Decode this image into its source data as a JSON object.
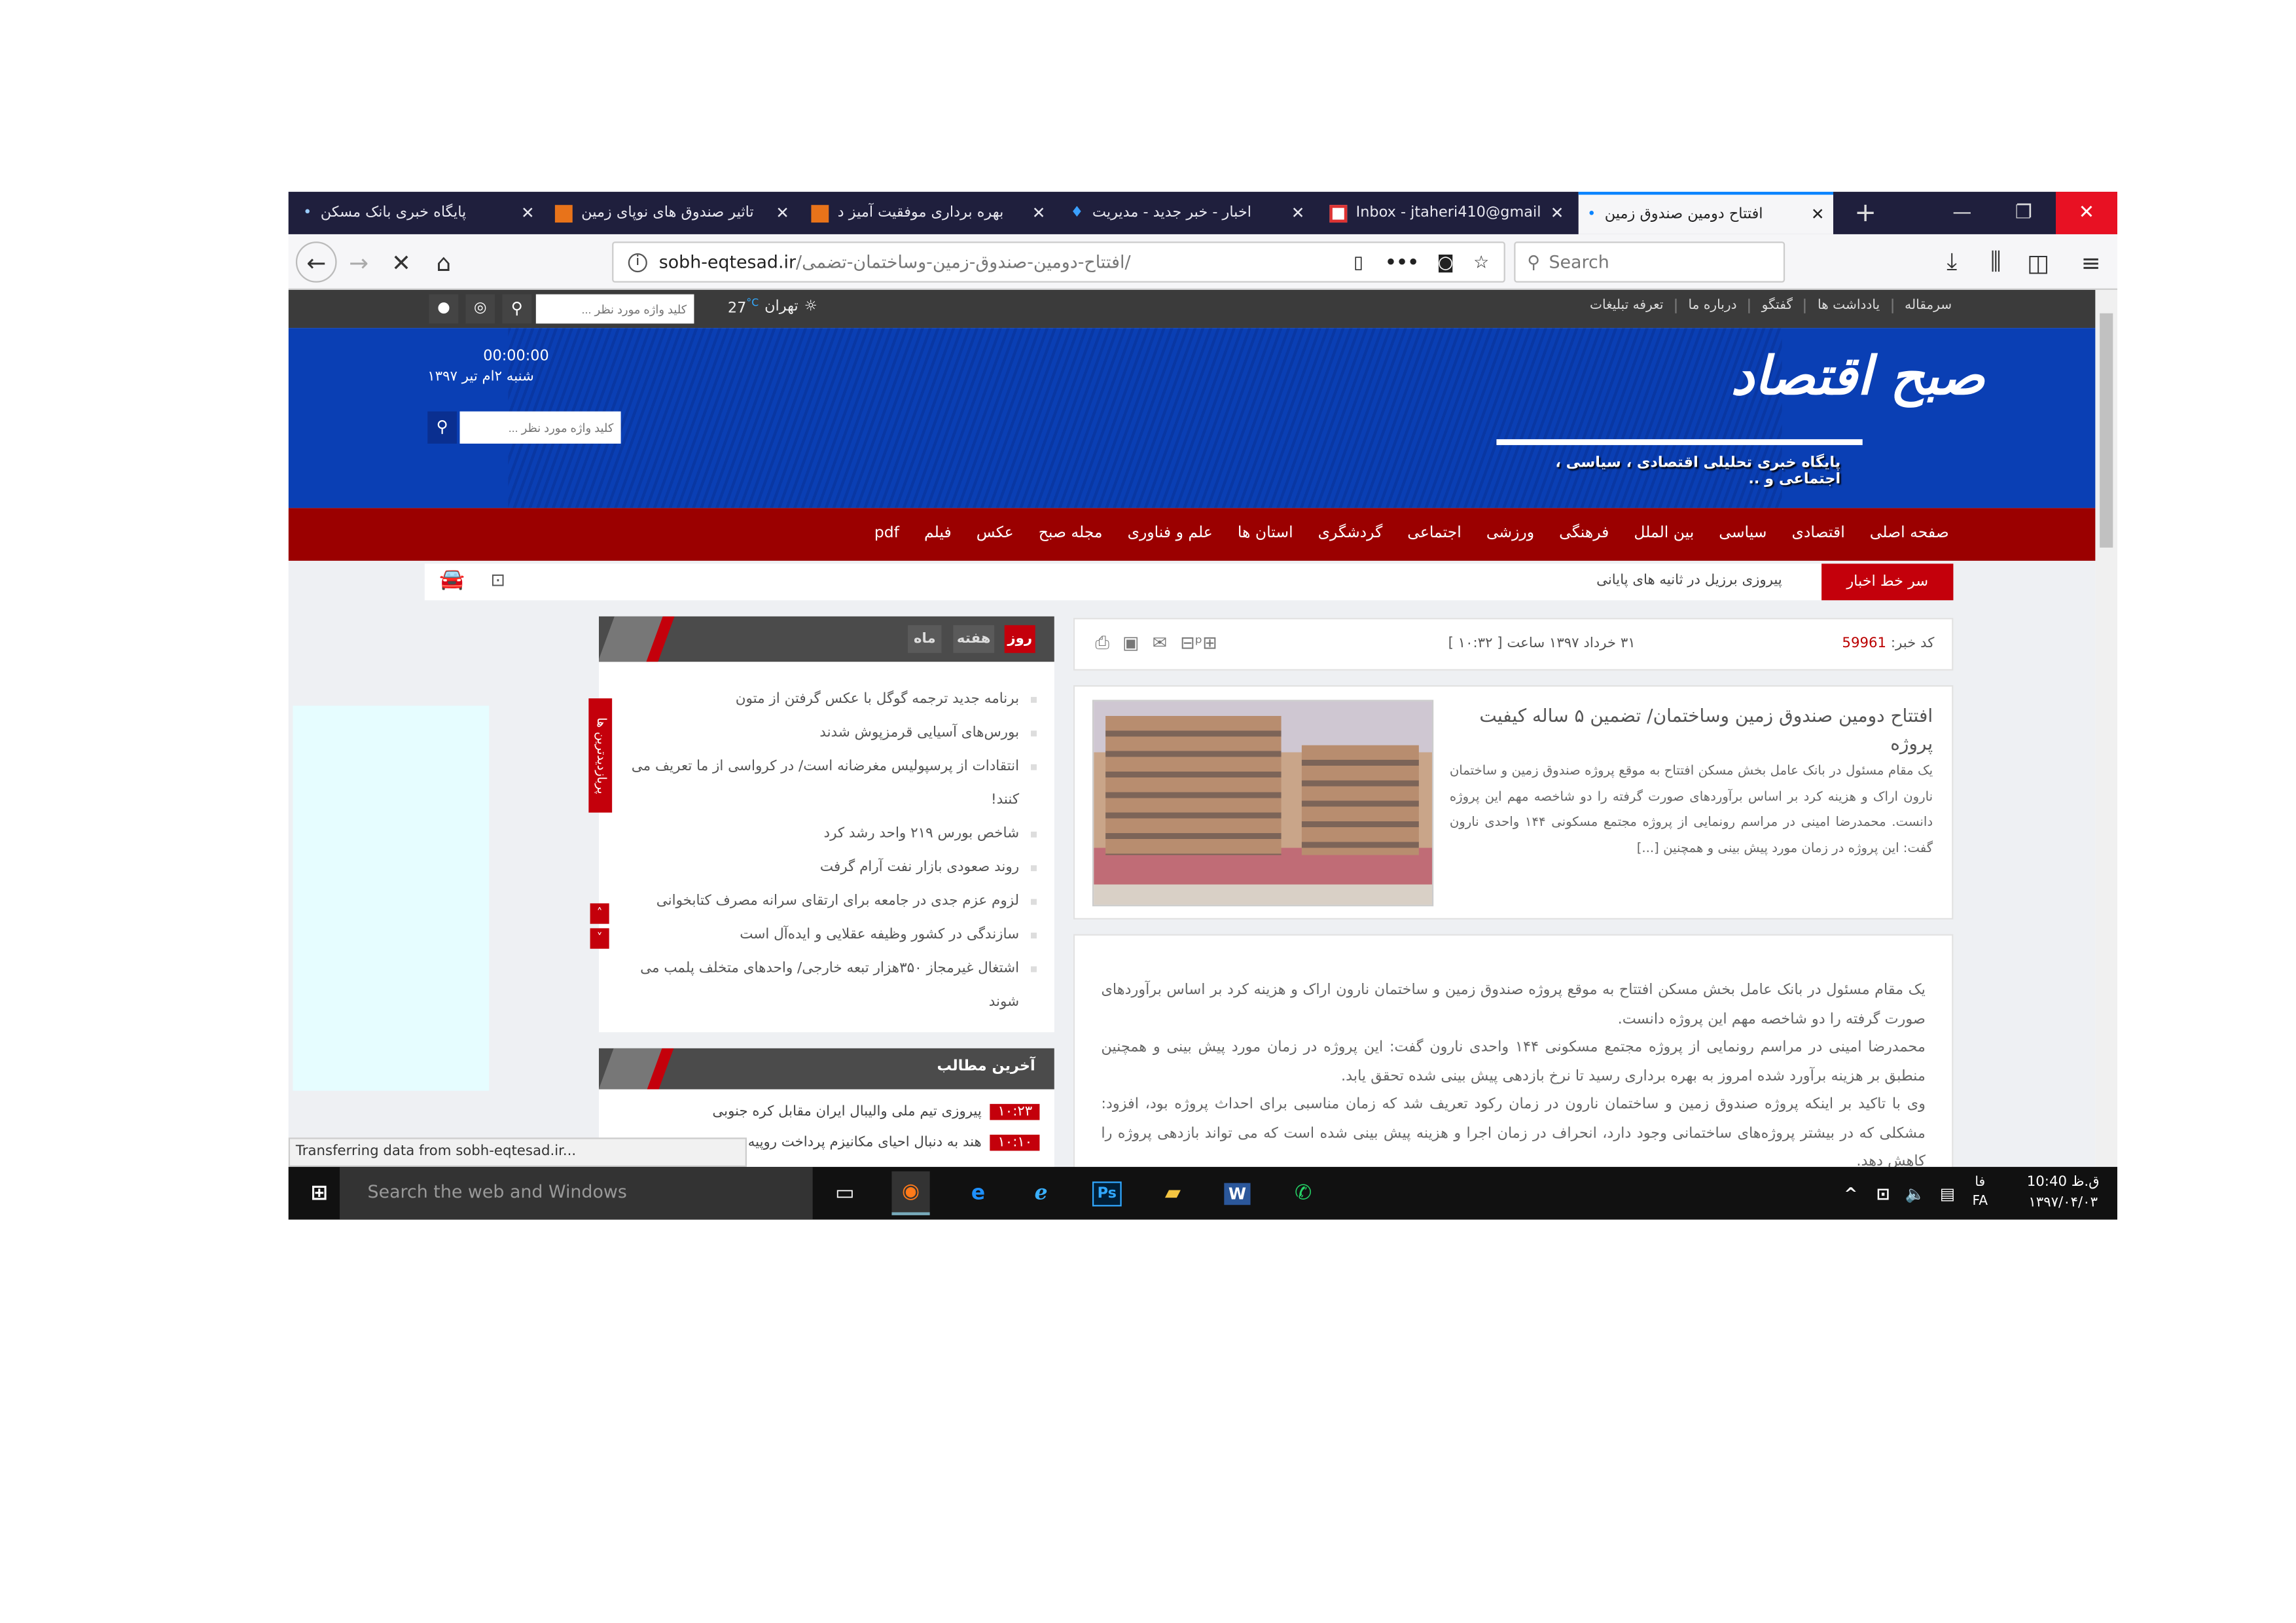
{
  "browser": {
    "tabs": [
      {
        "title": "پایگاه خبری بانک مسکن",
        "active": false
      },
      {
        "title": "تاثیر صندوق های نوپای زمین",
        "active": false
      },
      {
        "title": "بهره برداری موفقیت آمیز د",
        "active": false
      },
      {
        "title": "اخبار - خبر جدید - مدیریت",
        "active": false
      },
      {
        "title": "Inbox - jtaheri410@gmail",
        "active": false
      },
      {
        "title": "افتتاح دومین صندوق زمین",
        "active": true
      }
    ],
    "url_host": "sobh-eqtesad.ir",
    "url_path": "/افتتاح-دومین-صندوق-زمین-وساختمان-تضمی/",
    "search_placeholder": "Search",
    "status": "Transferring data from sobh-eqtesad.ir...",
    "accent": "#0a84ff"
  },
  "site": {
    "top_links": [
      "سرمقاله",
      "یادداشت ها",
      "گفتگو",
      "درباره ما",
      "تعرفه تبلیغات"
    ],
    "weather_city": "تهران",
    "weather_temp": "27",
    "weather_unit": "°C",
    "search_placeholder": "کلید واژه مورد نظر ...",
    "logo": "صبح اقتصاد",
    "tagline": "پایگاه خبری تحلیلی اقتصادی ، سیاسی ، اجتماعی و ..",
    "clock": "00:00:00",
    "date": "شنبه ۲ام تیر ۱۳۹۷",
    "nav": [
      "صفحه اصلی",
      "اقتصادی",
      "سیاسی",
      "بین الملل",
      "فرهنگی",
      "ورزشی",
      "اجتماعی",
      "گردشگری",
      "استان ها",
      "علم و فناوری",
      "مجله صبح",
      "عکس",
      "فیلم",
      "pdf"
    ],
    "ticker_label": "سر خط اخبار",
    "ticker_text": "پیروزی برزیل در ثانیه های پایانی",
    "colors": {
      "header_blue": "#0a3fb4",
      "nav_red": "#9b0000",
      "accent_red": "#c4000b"
    }
  },
  "article": {
    "code_label": "کد خبر:",
    "code": "59961",
    "date": "۳۱ خرداد ۱۳۹۷ ساعت [ ۱۰:۳۲ ]",
    "title": "افتتاح دومین صندوق زمین وساختمان/ تضمین ۵ ساله کیفیت پروژه",
    "lead": "یک مقام مسئول در بانک عامل بخش مسکن افتتاح به موقع پروژه صندوق زمین و ساختمان نارون اراک و هزینه کرد بر اساس برآوردهای صورت گرفته را دو شاخصه مهم این پروژه دانست.  محمدرضا امینی در مراسم رونمایی از پروژه مجتمع مسکونی ۱۴۴ واحدی نارون گفت: این پروژه در زمان مورد پیش بینی و همچنین [...]",
    "body": [
      "یک مقام مسئول در بانک عامل بخش مسکن افتتاح به موقع پروژه صندوق زمین و ساختمان نارون اراک و هزینه کرد بر اساس برآوردهای صورت گرفته را دو شاخصه مهم این پروژه دانست.",
      "محمدرضا امینی در مراسم رونمایی از پروژه مجتمع مسکونی ۱۴۴ واحدی نارون گفت: این پروژه در زمان مورد پیش بینی و همچنین منطبق بر هزینه برآورد شده امروز به بهره برداری رسید تا نرخ بازدهی پیش بینی شده تحقق یابد.",
      "وی با تاکید بر اینکه پروژه صندوق زمین و ساختمان نارون در زمان رکود تعریف شد که زمان مناسبی برای احداث پروژه بود، افزود: مشکلی که در بیشتر پروژه‌های ساختمانی وجود دارد، انحراف در زمان اجرا و هزینه پیش بینی شده است که می تواند بازدهی پروژه را کاهش دهد."
    ]
  },
  "popular": {
    "tabs": [
      "روز",
      "هفته",
      "ماه"
    ],
    "active_tab": "روز",
    "side_label": "پربازدیدترین ها",
    "items": [
      "برنامه جدید ترجمه گوگل با عکس گرفتن از متون",
      "بورس‌های آسیایی قرمزپوش شدند",
      "انتقادات از پرسپولیس مغرضانه است/ در کرواسی از ما تعریف می کنند!",
      "شاخص بورس ۲۱۹ واحد رشد کرد",
      "روند صعودی بازار نفت آرام گرفت",
      "لزوم عزم جدی در جامعه برای ارتقای سرانه مصرف کتابخوانی",
      "سازندگی در کشور وظیفه عقلایی و ایده‌آل است",
      "اشتغال غیرمجاز ۳۵۰هزار تبعه خارجی/ واحدهای متخلف پلمب می شوند"
    ]
  },
  "latest": {
    "title": "آخرین مطالب",
    "items": [
      {
        "time": "۱۰:۲۳",
        "text": "پیروزی تیم ملی والیبال ایران مقابل کره جنوبی"
      },
      {
        "time": "۱۰:۱۰",
        "text": "هند به دنبال احیای مکانیزم پرداخت روپیه"
      }
    ]
  },
  "taskbar": {
    "search_placeholder": "Search the web and Windows",
    "apps": [
      "task-view",
      "firefox",
      "edge",
      "internet-explorer",
      "photoshop",
      "file-explorer",
      "word",
      "whatsapp"
    ],
    "lang_top": "فا",
    "lang": "FA",
    "time": "10:40 ق.ظ",
    "date": "۱۳۹۷/۰۴/۰۳"
  }
}
